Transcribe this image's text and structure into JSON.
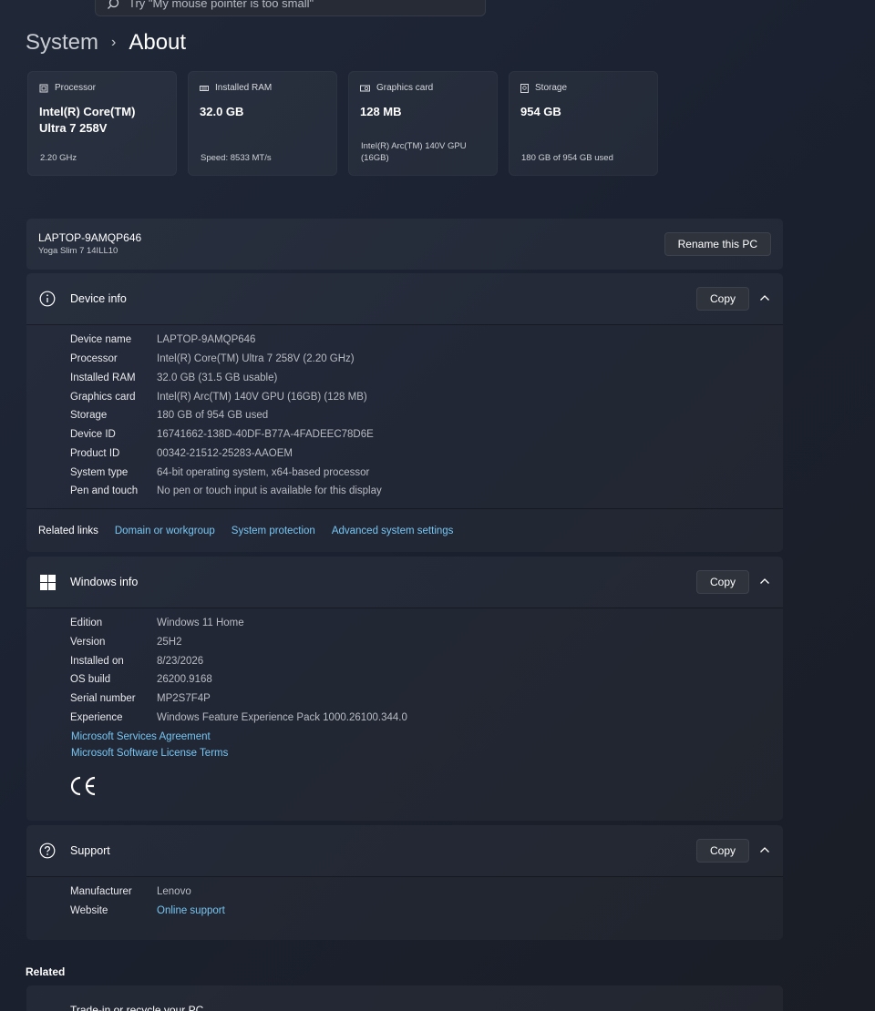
{
  "search": {
    "placeholder": "Try \"My mouse pointer is too small\""
  },
  "breadcrumb": {
    "parent": "System",
    "separator": "›",
    "current": "About"
  },
  "spec_cards": [
    {
      "icon": "processor-icon",
      "label": "Processor",
      "value": "Intel(R) Core(TM) Ultra 7 258V",
      "detail": "2.20 GHz"
    },
    {
      "icon": "ram-icon",
      "label": "Installed RAM",
      "value": "32.0 GB",
      "detail": "Speed: 8533 MT/s"
    },
    {
      "icon": "graphics-card-icon",
      "label": "Graphics card",
      "value": "128 MB",
      "detail": "Intel(R) Arc(TM) 140V GPU (16GB)"
    },
    {
      "icon": "storage-icon",
      "label": "Storage",
      "value": "954 GB",
      "detail": "180 GB of 954 GB used"
    }
  ],
  "pc": {
    "name": "LAPTOP-9AMQP646",
    "model": "Yoga Slim 7 14ILL10",
    "rename_label": "Rename this PC"
  },
  "device_info": {
    "title": "Device info",
    "copy_label": "Copy",
    "rows": [
      {
        "key": "Device name",
        "value": "LAPTOP-9AMQP646"
      },
      {
        "key": "Processor",
        "value": "Intel(R) Core(TM) Ultra 7 258V (2.20 GHz)"
      },
      {
        "key": "Installed RAM",
        "value": "32.0 GB (31.5 GB usable)"
      },
      {
        "key": "Graphics card",
        "value": "Intel(R) Arc(TM) 140V GPU (16GB) (128 MB)"
      },
      {
        "key": "Storage",
        "value": "180 GB of 954 GB used"
      },
      {
        "key": "Device ID",
        "value": "16741662-138D-40DF-B77A-4FADEEC78D6E"
      },
      {
        "key": "Product ID",
        "value": "00342-21512-25283-AAOEM"
      },
      {
        "key": "System type",
        "value": "64-bit operating system, x64-based processor"
      },
      {
        "key": "Pen and touch",
        "value": "No pen or touch input is available for this display"
      }
    ]
  },
  "related_links": {
    "label": "Related links",
    "links": [
      "Domain or workgroup",
      "System protection",
      "Advanced system settings"
    ]
  },
  "windows_info": {
    "title": "Windows info",
    "copy_label": "Copy",
    "rows": [
      {
        "key": "Edition",
        "value": "Windows 11 Home"
      },
      {
        "key": "Version",
        "value": "25H2"
      },
      {
        "key": "Installed on",
        "value": "8/23/2026"
      },
      {
        "key": "OS build",
        "value": "26200.9168"
      },
      {
        "key": "Serial number",
        "value": "MP2S7F4P"
      },
      {
        "key": "Experience",
        "value": "Windows Feature Experience Pack 1000.26100.344.0"
      }
    ],
    "links": [
      "Microsoft Services Agreement",
      "Microsoft Software License Terms"
    ],
    "ce_mark": "CE"
  },
  "support": {
    "title": "Support",
    "copy_label": "Copy",
    "rows": [
      {
        "key": "Manufacturer",
        "value": "Lenovo",
        "is_link": false
      },
      {
        "key": "Website",
        "value": "Online support",
        "is_link": true
      }
    ]
  },
  "related": {
    "heading": "Related",
    "item_label": "Trade-in or recycle your PC"
  },
  "colors": {
    "link": "#77c6f2",
    "background": "#1b2130",
    "card": "#272c37"
  }
}
